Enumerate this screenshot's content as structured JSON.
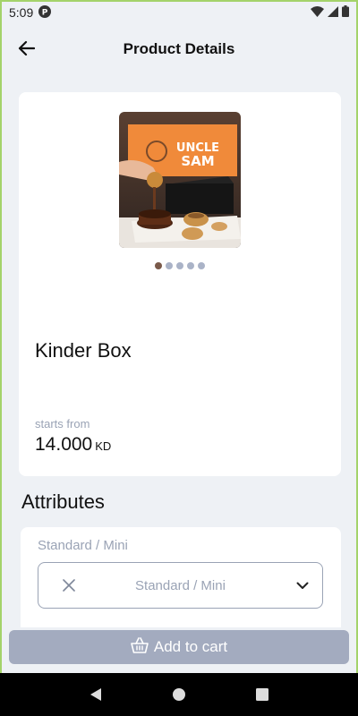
{
  "status_bar": {
    "time": "5:09",
    "icons": [
      "app-notification-icon",
      "wifi-icon",
      "signal-icon",
      "battery-icon"
    ]
  },
  "app_bar": {
    "title": "Product Details",
    "back_icon": "arrow-left-icon"
  },
  "product": {
    "name": "Kinder Box",
    "price_prefix": "starts from",
    "price": "14.000",
    "currency": "KD",
    "image_slide": {
      "current": 1,
      "total": 5
    },
    "image_sign_text": "UNCLE SAM"
  },
  "attributes": {
    "title": "Attributes",
    "items": [
      {
        "label": "Standard / Mini",
        "selected_value": "Standard / Mini",
        "clear_icon": "close-icon",
        "dropdown_icon": "chevron-down-icon"
      }
    ]
  },
  "cart": {
    "button_label": "Add to cart",
    "icon": "basket-icon"
  },
  "colors": {
    "background": "#eef1f5",
    "card": "#ffffff",
    "muted_text": "#9aa3b5",
    "button_disabled": "#a3abbf",
    "active_dot": "#7a5a4a"
  }
}
